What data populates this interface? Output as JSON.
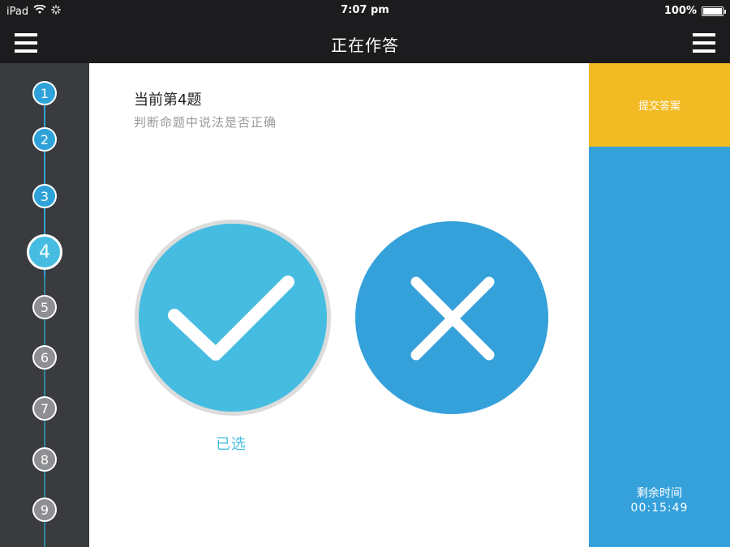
{
  "status_bar": {
    "device": "iPad",
    "time": "7:07 pm",
    "battery": "100%",
    "battery_level": 1.0,
    "icons": [
      "wifi-icon",
      "activity-spinner-icon",
      "battery-icon"
    ]
  },
  "nav": {
    "title": "正在作答",
    "left_icon": "menu-icon",
    "right_icon": "menu-icon"
  },
  "sidebar": {
    "questions": [
      {
        "label": "1",
        "state": "done"
      },
      {
        "label": "2",
        "state": "done"
      },
      {
        "label": "3",
        "state": "done"
      },
      {
        "label": "4",
        "state": "current"
      },
      {
        "label": "5",
        "state": "pending"
      },
      {
        "label": "6",
        "state": "pending"
      },
      {
        "label": "7",
        "state": "pending"
      },
      {
        "label": "8",
        "state": "pending"
      },
      {
        "label": "9",
        "state": "pending"
      }
    ]
  },
  "question": {
    "title": "当前第4题",
    "subtitle": "判断命题中说法是否正确",
    "choices": [
      {
        "name": "true",
        "icon": "checkmark-icon",
        "selected": true
      },
      {
        "name": "false",
        "icon": "cross-icon",
        "selected": false
      }
    ],
    "selected_label": "已选"
  },
  "right_panel": {
    "submit_label": "提交答案",
    "timer_label": "剩余时间",
    "timer_value": "00:15:49"
  },
  "colors": {
    "bar_bg": "#1c1c1e",
    "sidebar_bg": "#3a3b3f",
    "accent_blue": "#35a1db",
    "light_blue": "#46bde0",
    "submit_yellow": "#f2bb23",
    "pending_gray": "#8e8f92"
  }
}
